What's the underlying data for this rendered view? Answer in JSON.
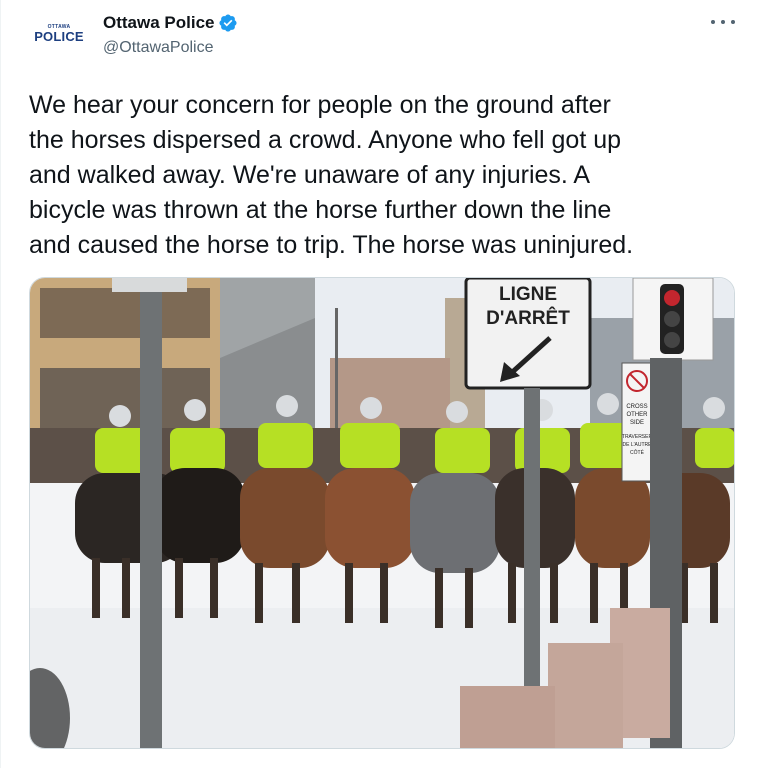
{
  "author": {
    "display_name": "Ottawa Police",
    "handle": "@OttawaPolice",
    "avatar_small": "OTTAWA",
    "avatar_big": "POLICE",
    "verified": true,
    "verified_icon": "verified-badge-icon"
  },
  "tweet": {
    "text": "We hear your concern for people on the ground after\nthe horses dispersed a crowd. Anyone who fell got up\nand walked away. We're unaware of any injuries. A\nbicycle was thrown at the horse further down the line\nand caused the horse to trip. The horse was uninjured."
  },
  "media": {
    "sign_main_line1": "LIGNE",
    "sign_main_line2": "D'ARRÊT",
    "sign_small_line1": "CROSS",
    "sign_small_line2": "OTHER",
    "sign_small_line3": "SIDE",
    "sign_small_line4": "TRAVERSER",
    "sign_small_line5": "DE L'AUTRE",
    "sign_small_line6": "CÔTÉ"
  },
  "colors": {
    "accent": "#1d9bf0",
    "text": "#0f1419",
    "secondary": "#536471",
    "hi_vis": "#b6e024",
    "police_blue": "#1d3f80"
  },
  "icons": [
    "more-options-icon",
    "verified-badge-icon"
  ]
}
